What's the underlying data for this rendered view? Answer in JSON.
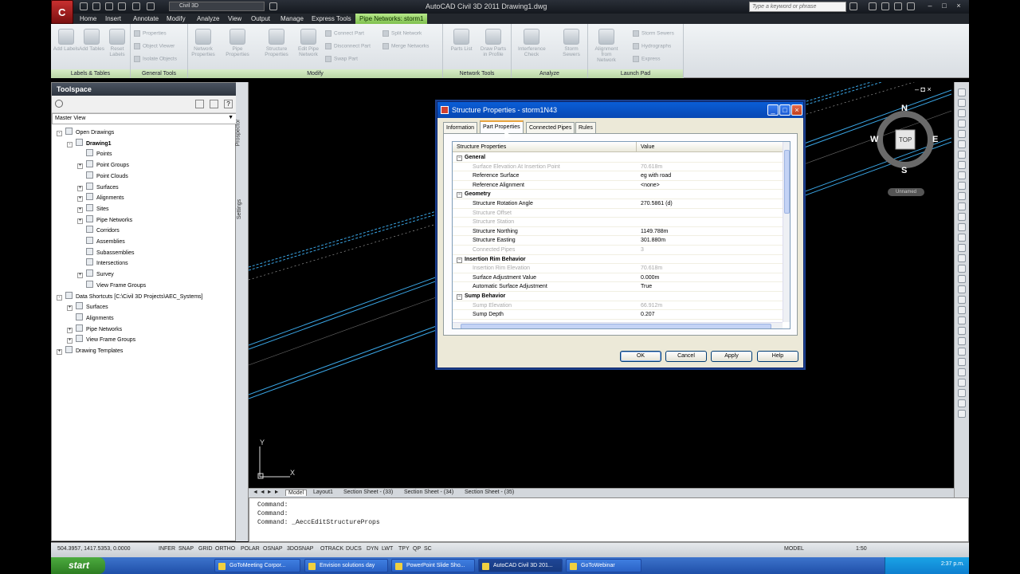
{
  "window": {
    "title": "AutoCAD Civil 3D 2011    Drawing1.dwg",
    "workspace": "Civil 3D",
    "search_placeholder": "Type a keyword or phrase"
  },
  "menu": [
    "Home",
    "Insert",
    "Annotate",
    "Modify",
    "Analyze",
    "View",
    "Output",
    "Manage",
    "Express Tools"
  ],
  "contextual_tab": "Pipe Networks: storm1",
  "ribbon": {
    "panels": [
      {
        "title": "Labels & Tables",
        "big": [
          "Add Labels",
          "Add Tables",
          "Reset Labels"
        ]
      },
      {
        "title": "General Tools",
        "small": [
          "Properties",
          "Object Viewer",
          "Isolate Objects"
        ]
      },
      {
        "title": "Modify",
        "big": [
          "Network Properties",
          "Pipe Properties",
          "Structure Properties",
          "Edit Pipe Network"
        ],
        "small": [
          "Connect Part",
          "Disconnect Part",
          "Swap Part",
          "Split Network",
          "Merge Networks"
        ]
      },
      {
        "title": "Network Tools",
        "big": [
          "Parts List",
          "Draw Parts in Profile"
        ]
      },
      {
        "title": "Analyze",
        "big": [
          "Interference Check",
          "Storm Sewers"
        ]
      },
      {
        "title": "Launch Pad",
        "big": [
          "Alignment from Network"
        ],
        "small": [
          "Storm Sewers",
          "Hydrographs",
          "Express"
        ]
      }
    ]
  },
  "toolspace": {
    "title": "Toolspace",
    "view": "Master View",
    "side_tabs": [
      "Prospector",
      "Settings"
    ],
    "tree": [
      {
        "label": "Open Drawings",
        "level": 0,
        "tog": "-"
      },
      {
        "label": "Drawing1",
        "level": 1,
        "tog": "-",
        "bold": true
      },
      {
        "label": "Points",
        "level": 2,
        "tog": ""
      },
      {
        "label": "Point Groups",
        "level": 2,
        "tog": "+"
      },
      {
        "label": "Point Clouds",
        "level": 2,
        "tog": ""
      },
      {
        "label": "Surfaces",
        "level": 2,
        "tog": "+"
      },
      {
        "label": "Alignments",
        "level": 2,
        "tog": "+"
      },
      {
        "label": "Sites",
        "level": 2,
        "tog": "+"
      },
      {
        "label": "Pipe Networks",
        "level": 2,
        "tog": "+"
      },
      {
        "label": "Corridors",
        "level": 2,
        "tog": ""
      },
      {
        "label": "Assemblies",
        "level": 2,
        "tog": ""
      },
      {
        "label": "Subassemblies",
        "level": 2,
        "tog": ""
      },
      {
        "label": "Intersections",
        "level": 2,
        "tog": ""
      },
      {
        "label": "Survey",
        "level": 2,
        "tog": "+"
      },
      {
        "label": "View Frame Groups",
        "level": 2,
        "tog": ""
      },
      {
        "label": "Data Shortcuts [C:\\Civil 3D Projects\\AEC_Systems]",
        "level": 0,
        "tog": "-"
      },
      {
        "label": "Surfaces",
        "level": 1,
        "tog": "+"
      },
      {
        "label": "Alignments",
        "level": 1,
        "tog": ""
      },
      {
        "label": "Pipe Networks",
        "level": 1,
        "tog": "+"
      },
      {
        "label": "View Frame Groups",
        "level": 1,
        "tog": "+"
      },
      {
        "label": "Drawing Templates",
        "level": 0,
        "tog": "+"
      }
    ]
  },
  "viewcube": {
    "n": "N",
    "s": "S",
    "e": "E",
    "w": "W",
    "face": "TOP",
    "wcs": "Unnamed"
  },
  "ucs": {
    "x": "X",
    "y": "Y"
  },
  "layout_tabs": [
    "Model",
    "Layout1",
    "Section Sheet - (33)",
    "Section Sheet - (34)",
    "Section Sheet - (35)"
  ],
  "command": [
    "Command:",
    "Command:",
    "Command: _AeccEditStructureProps"
  ],
  "status": {
    "coords": "504.3957, 1417.5353, 0.0000",
    "toggles": [
      "INFER",
      "SNAP",
      "GRID",
      "ORTHO",
      "POLAR",
      "OSNAP",
      "3DOSNAP",
      "OTRACK",
      "DUCS",
      "DYN",
      "LWT",
      "TPY",
      "QP",
      "SC"
    ],
    "model": "MODEL",
    "scale": "1:50"
  },
  "taskbar": {
    "start": "start",
    "tasks": [
      "GoToMeeting Corpor...",
      "Envision solutions day",
      "PowerPoint Slide Sho...",
      "AutoCAD Civil 3D 201...",
      "GoToWebinar"
    ],
    "clock": "2:37 p.m."
  },
  "dialog": {
    "title": "Structure Properties - storm1N43",
    "tabs": [
      "Information",
      "Part Properties",
      "Connected Pipes",
      "Rules"
    ],
    "active_tab": 1,
    "columns": [
      "Structure Properties",
      "Value"
    ],
    "rows": [
      {
        "type": "cat",
        "k": "General"
      },
      {
        "type": "dis",
        "k": "Surface Elevation At Insertion Point",
        "v": "70.618m"
      },
      {
        "type": "row",
        "k": "Reference Surface",
        "v": "eg with road"
      },
      {
        "type": "row",
        "k": "Reference Alignment",
        "v": "<none>"
      },
      {
        "type": "cat",
        "k": "Geometry"
      },
      {
        "type": "row",
        "k": "Structure Rotation Angle",
        "v": "270.5861 (d)"
      },
      {
        "type": "dis",
        "k": "Structure Offset",
        "v": ""
      },
      {
        "type": "dis",
        "k": "Structure Station",
        "v": ""
      },
      {
        "type": "row",
        "k": "Structure Northing",
        "v": "1149.788m"
      },
      {
        "type": "row",
        "k": "Structure Easting",
        "v": "301.880m"
      },
      {
        "type": "dis",
        "k": "Connected Pipes",
        "v": "3"
      },
      {
        "type": "cat",
        "k": "Insertion Rim Behavior"
      },
      {
        "type": "dis",
        "k": "Insertion Rim Elevation",
        "v": "70.618m"
      },
      {
        "type": "row",
        "k": "Surface Adjustment Value",
        "v": "0.000m"
      },
      {
        "type": "row",
        "k": "Automatic Surface Adjustment",
        "v": "True"
      },
      {
        "type": "cat",
        "k": "Sump Behavior"
      },
      {
        "type": "dis",
        "k": "Sump Elevation",
        "v": "66.912m"
      },
      {
        "type": "row",
        "k": "Sump Depth",
        "v": "0.207"
      }
    ],
    "buttons": [
      "OK",
      "Cancel",
      "Apply",
      "Help"
    ]
  }
}
